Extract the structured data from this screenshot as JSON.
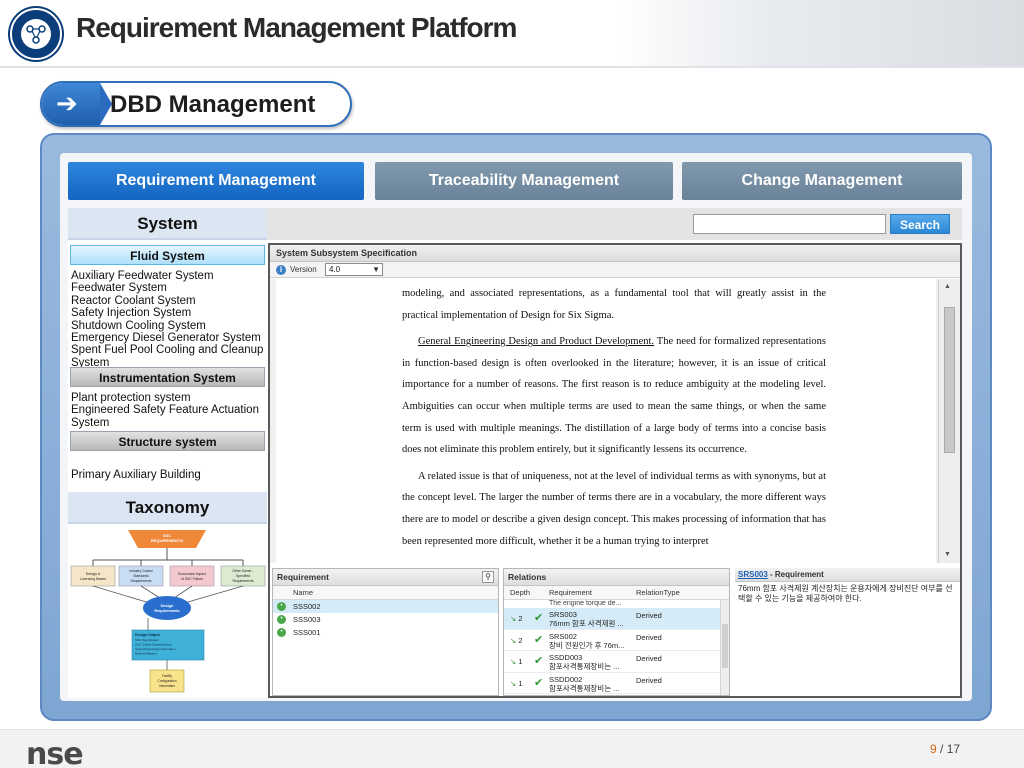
{
  "header": {
    "title": "Requirement Management Platform"
  },
  "section": {
    "title": "DBD Management"
  },
  "tabs": [
    {
      "label": "Requirement Management",
      "active": true
    },
    {
      "label": "Traceability Management",
      "active": false
    },
    {
      "label": "Change Management",
      "active": false
    }
  ],
  "left_panel": {
    "system_title": "System",
    "fluid_title": "Fluid System",
    "fluid_items": [
      "Auxiliary Feedwater System",
      "Feedwater System",
      "Reactor Coolant System",
      "Safety Injection System",
      "Shutdown Cooling System",
      "Emergency Diesel Generator System",
      "Spent Fuel Pool Cooling and Cleanup System"
    ],
    "instrumentation_title": "Instrumentation System",
    "instrumentation_items": [
      "Plant protection system",
      "Engineered Safety Feature Actuation System"
    ],
    "structure_title": "Structure system",
    "structure_items": [
      "Primary Auxiliary Building"
    ],
    "taxonomy_title": "Taxonomy"
  },
  "taxonomy": {
    "top": "SSC\nREQUIREMENTS",
    "top_l1": "SSC",
    "top_l2": "REQUIREMENTS",
    "b1_l1": "Design &",
    "b1_l2": "Licensing Bases",
    "b2_l1": "Industry Codes/",
    "b2_l2": "Standards",
    "b2_l3": "Requirements",
    "b3_l1": "Economics Impact",
    "b3_l2": "of SSC Failure",
    "b4_l1": "Other Owner -",
    "b4_l2": "Specified",
    "b4_l3": "Requirements",
    "oval_l1": "Design",
    "oval_l2": "Requirements",
    "out_title": "Design Output",
    "out_1": "SSC Specification",
    "out_2": "SSC Critical Characteristics",
    "out_3": "Supporting Design Information",
    "out_4": "Defined Margins",
    "fac_l1": "Facility",
    "fac_l2": "Configuration",
    "fac_l3": "Information"
  },
  "search": {
    "placeholder": "",
    "button": "Search"
  },
  "document": {
    "title": "System Subsystem Specification",
    "version_label": "Version",
    "version_value": "4.0",
    "para1": "modeling, and associated representations, as a fundamental tool that will greatly assist in the practical implementation of Design for Six Sigma.",
    "para2_head": "General Engineering Design and Product Development.",
    "para2": " The need for formalized representations in function-based design is often overlooked in the literature; however, it is an issue of critical importance for a number of reasons.  The first reason is to reduce ambiguity at the modeling level.  Ambiguities can occur when multiple terms are used to mean the same things, or when the same term is used with multiple meanings.  The distillation of a large body of terms into a concise basis does not eliminate this problem entirely, but it significantly lessens its occurrence.",
    "para3": "A related issue is that of uniqueness, not at the level of individual terms as with synonyms, but at the concept level.  The larger the number of terms there are in a vocabulary, the more different ways there are to model or describe a given design concept.  This makes processing of information that has been represented more difficult, whether it be a human trying to interpret"
  },
  "requirement_panel": {
    "title": "Requirement",
    "col_name": "Name",
    "rows": [
      "SSS002",
      "SSS003",
      "SSS001"
    ]
  },
  "relations_panel": {
    "title": "Relations",
    "col_depth": "Depth",
    "col_requirement": "Requirement",
    "col_type": "RelationType",
    "partial_row": "The engine torque de...",
    "rows": [
      {
        "depth": "2",
        "id": "SRS003",
        "desc": "76mm 함포 사격제원 ...",
        "type": "Derived"
      },
      {
        "depth": "2",
        "id": "SRS002",
        "desc": "장비 전원인가 후 76m...",
        "type": "Derived"
      },
      {
        "depth": "1",
        "id": "SSDD003",
        "desc": "함포사격통제장비는 ...",
        "type": "Derived"
      },
      {
        "depth": "1",
        "id": "SSDD002",
        "desc": "함포사격통제장비는 ...",
        "type": "Derived"
      }
    ]
  },
  "srs_panel": {
    "id": "SRS003",
    "suffix": " - Requirement",
    "text": "76mm 함포 사격제원 계산장치는 운용자에게 장비진단 여부를 선택할 수 있는 기능을 제공하여야 한다."
  },
  "footer": {
    "logo": "nse",
    "page_current": "9",
    "page_total": " / 17"
  },
  "colors": {
    "accent": "#1365c1",
    "frame": "#7ea6d3",
    "tab_inactive": "#6a8398"
  }
}
